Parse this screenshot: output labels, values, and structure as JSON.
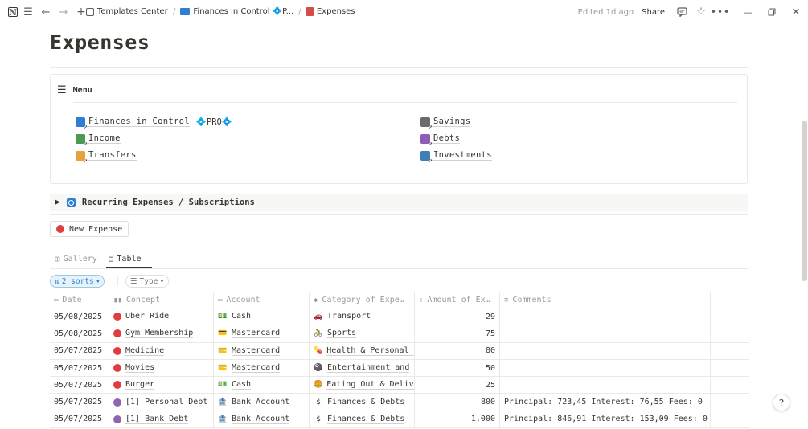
{
  "topbar": {
    "breadcrumbs": [
      {
        "label": "Templates Center",
        "icon": "template-icon"
      },
      {
        "label": "Finances in Control 💠P...",
        "icon": "folder-icon"
      },
      {
        "label": "Expenses",
        "icon": "book-icon"
      }
    ],
    "edited": "Edited 1d ago",
    "share": "Share"
  },
  "page": {
    "title": "Expenses"
  },
  "menu": {
    "title": "Menu",
    "links_left": [
      {
        "label": "Finances in Control",
        "suffix": "💠PRO💠",
        "color": "#2d7fd3"
      },
      {
        "label": "Income",
        "suffix": "",
        "color": "#4c9a52"
      },
      {
        "label": "Transfers",
        "suffix": "",
        "color": "#e6a23c"
      }
    ],
    "links_right": [
      {
        "label": "Savings",
        "suffix": "",
        "color": "#6b6b6b"
      },
      {
        "label": "Debts",
        "suffix": "",
        "color": "#8e5bb8"
      },
      {
        "label": "Investments",
        "suffix": "",
        "color": "#3f7fb8"
      }
    ]
  },
  "toggle": {
    "label": "Recurring Expenses / Subscriptions"
  },
  "new_button": {
    "label": "New Expense"
  },
  "tabs": [
    {
      "label": "Gallery",
      "active": false
    },
    {
      "label": "Table",
      "active": true
    }
  ],
  "filters": {
    "sorts": "2 sorts",
    "type": "Type"
  },
  "table": {
    "columns": [
      "Date",
      "Concept",
      "Account",
      "Category of Expe…",
      "Amount of Ex…",
      "Comments"
    ],
    "rows": [
      {
        "date": "05/08/2025",
        "concept": "Uber Ride",
        "dot": "red",
        "account": "Cash",
        "account_icon": "💵",
        "category": "Transport",
        "cat_icon": "🚗",
        "amount": "29",
        "comments": ""
      },
      {
        "date": "05/08/2025",
        "concept": "Gym Membership",
        "dot": "red",
        "account": "Mastercard",
        "account_icon": "💳",
        "category": "Sports",
        "cat_icon": "🚴",
        "amount": "75",
        "comments": ""
      },
      {
        "date": "05/07/2025",
        "concept": "Medicine",
        "dot": "red",
        "account": "Mastercard",
        "account_icon": "💳",
        "category": "Health & Personal C",
        "cat_icon": "💊",
        "amount": "80",
        "comments": ""
      },
      {
        "date": "05/07/2025",
        "concept": "Movies",
        "dot": "red",
        "account": "Mastercard",
        "account_icon": "💳",
        "category": "Entertainment and",
        "cat_icon": "🎱",
        "amount": "50",
        "comments": ""
      },
      {
        "date": "05/07/2025",
        "concept": "Burger",
        "dot": "red",
        "account": "Cash",
        "account_icon": "💵",
        "category": "Eating Out & Deliv",
        "cat_icon": "🍔",
        "amount": "25",
        "comments": ""
      },
      {
        "date": "05/07/2025",
        "concept": "[1] Personal Debt",
        "dot": "purple",
        "account": "Bank Account",
        "account_icon": "🏦",
        "category": "Finances & Debts",
        "cat_icon": "$",
        "amount": "800",
        "comments": "Principal: 723,45 Interest: 76,55 Fees: 0"
      },
      {
        "date": "05/07/2025",
        "concept": "[1] Bank Debt",
        "dot": "purple",
        "account": "Bank Account",
        "account_icon": "🏦",
        "category": "Finances & Debts",
        "cat_icon": "$",
        "amount": "1,000",
        "comments": "Principal: 846,91 Interest: 153,09 Fees: 0"
      }
    ]
  }
}
